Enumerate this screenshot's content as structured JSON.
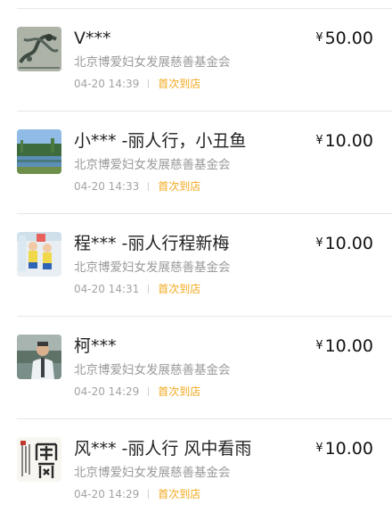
{
  "donations": [
    {
      "name": "V***",
      "currency": "¥",
      "amount": "50.00",
      "org": "北京博爱妇女发展慈善基金会",
      "time": "04-20 14:39",
      "tag": "首次到店",
      "avatar_icon": "dragon-painting-avatar-icon"
    },
    {
      "name": "小*** -丽人行，小丑鱼",
      "currency": "¥",
      "amount": "10.00",
      "org": "北京博爱妇女发展慈善基金会",
      "time": "04-20 14:33",
      "tag": "首次到店",
      "avatar_icon": "lake-landscape-avatar-icon"
    },
    {
      "name": "程*** -丽人行程新梅",
      "currency": "¥",
      "amount": "10.00",
      "org": "北京博爱妇女发展慈善基金会",
      "time": "04-20 14:31",
      "tag": "首次到店",
      "avatar_icon": "children-photo-avatar-icon"
    },
    {
      "name": "柯***",
      "currency": "¥",
      "amount": "10.00",
      "org": "北京博爱妇女发展慈善基金会",
      "time": "04-20 14:29",
      "tag": "首次到店",
      "avatar_icon": "man-portrait-avatar-icon"
    },
    {
      "name": "风*** -丽人行 风中看雨",
      "currency": "¥",
      "amount": "10.00",
      "org": "北京博爱妇女发展慈善基金会",
      "time": "04-20 14:29",
      "tag": "首次到店",
      "avatar_icon": "calligraphy-avatar-icon"
    }
  ]
}
